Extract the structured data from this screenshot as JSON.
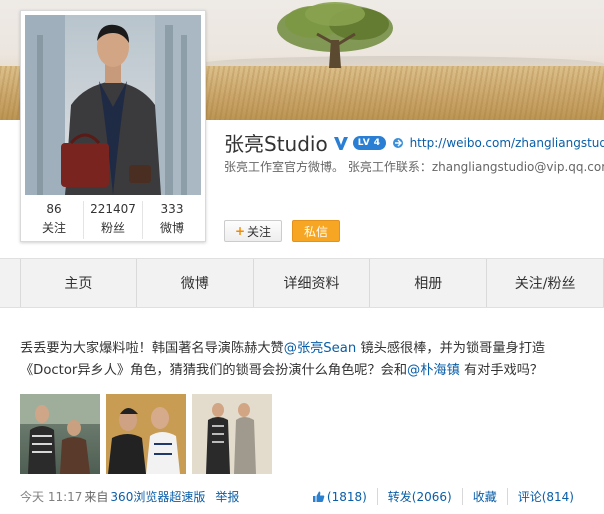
{
  "profile": {
    "name": "张亮Studio",
    "verified_icon": "verified-v-icon",
    "level": "LV 4",
    "link": "http://weibo.com/zhangliangstudio",
    "bio": "张亮工作室官方微博。 张亮工作联系：zhangliangstudio@vip.qq.com",
    "stats": [
      {
        "value": "86",
        "label": "关注"
      },
      {
        "value": "221407",
        "label": "粉丝"
      },
      {
        "value": "333",
        "label": "微博"
      }
    ],
    "follow_label": "关注",
    "message_label": "私信"
  },
  "tabs": [
    "主页",
    "微博",
    "详细资料",
    "相册",
    "关注/粉丝"
  ],
  "post": {
    "line1_a": "丢丢要为大家爆料啦！韩国著名导演陈赫大赞",
    "mention1": "@张亮Sean",
    "line1_b": " 镜头感很棒，并为锁哥量身打造",
    "line2_a": "《Doctor异乡人》角色，猜猜我们的锁哥会扮演什么角色呢？会和",
    "mention2": "@朴海镇",
    "line2_b": " 有对手戏吗？",
    "time": "今天 11:17",
    "source_prefix": "来自",
    "source": "360浏览器超速版",
    "report": "举报",
    "like_count": "(1818)",
    "repost": "转发(2066)",
    "favorite": "收藏",
    "comment": "评论(814)"
  },
  "colors": {
    "link_blue": "#0a5ea8",
    "message_button": "#f6a623",
    "tab_bg": "#f2f2f2",
    "level_badge": "#2a7fd4"
  }
}
